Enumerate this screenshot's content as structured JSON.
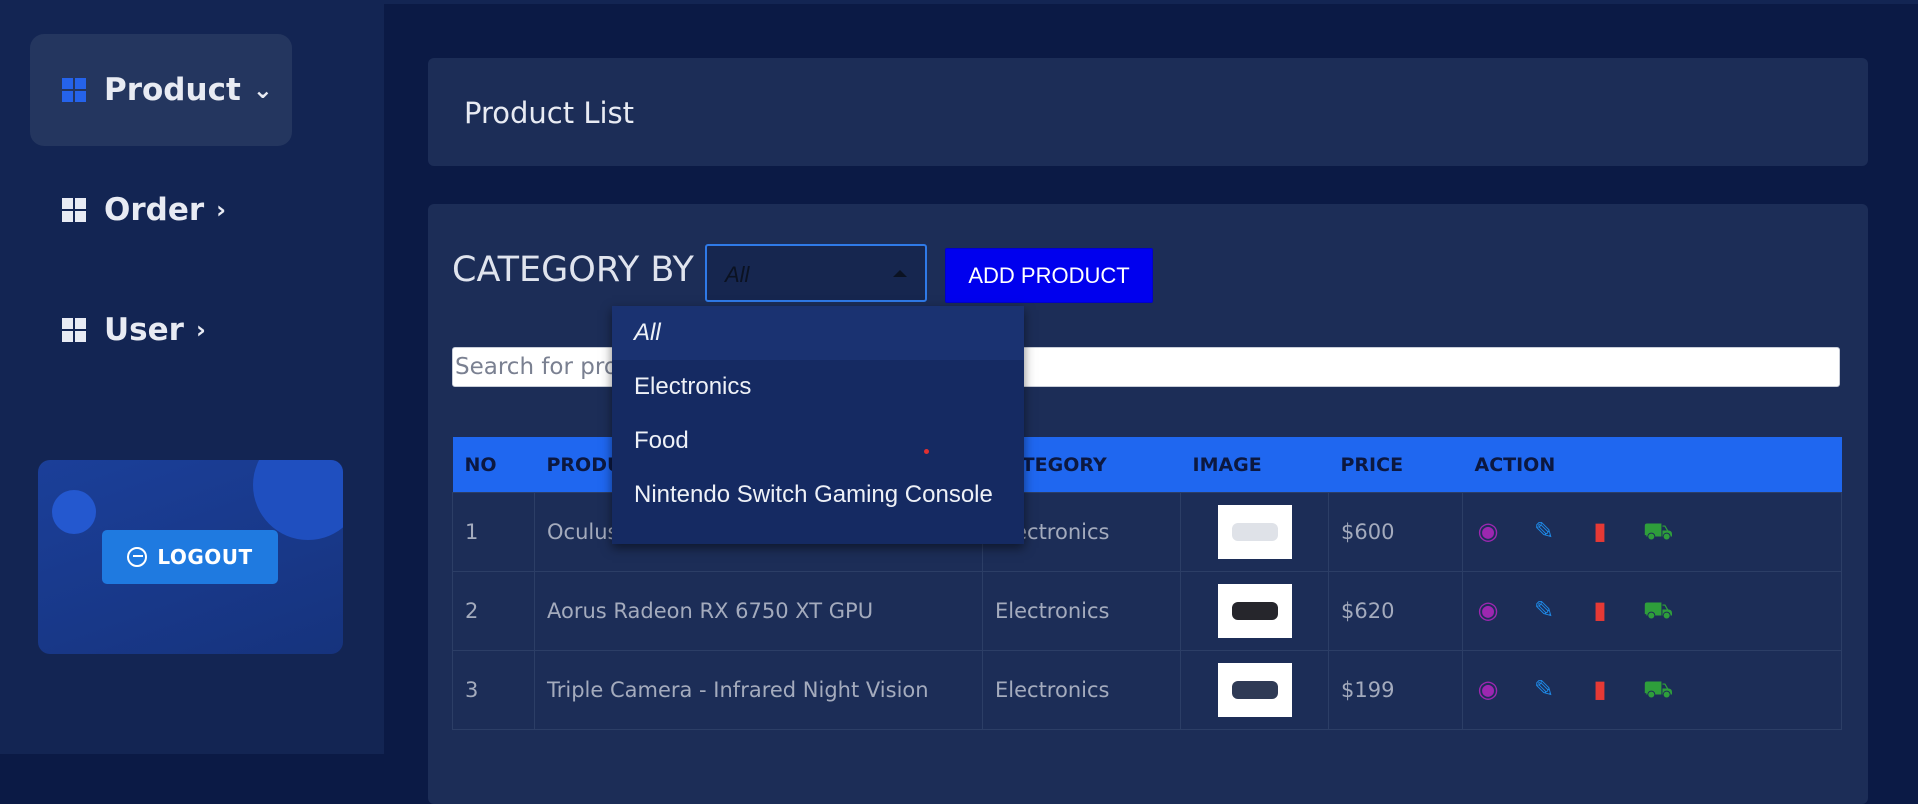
{
  "sidebar": {
    "items": [
      {
        "label": "Product",
        "icon": "dashboard-icon",
        "chevron": "chevron-down-icon"
      },
      {
        "label": "Order",
        "icon": "dashboard-icon",
        "chevron": "chevron-right-icon"
      },
      {
        "label": "User",
        "icon": "dashboard-icon",
        "chevron": "chevron-right-icon"
      }
    ],
    "logout_label": "LOGOUT"
  },
  "main": {
    "title": "Product List",
    "category_label": "CATEGORY BY",
    "category_selected": "All",
    "add_button": "ADD PRODUCT",
    "search_placeholder": "Search for products"
  },
  "dropdown": {
    "options": [
      "All",
      "Electronics",
      "Food",
      "Nintendo Switch Gaming Console"
    ]
  },
  "table": {
    "headers": [
      "NO",
      "PRODUCT",
      "CATEGORY",
      "IMAGE",
      "PRICE",
      "ACTION"
    ],
    "rows": [
      {
        "no": "1",
        "product": "Oculus",
        "category": "Electronics",
        "price": "$600"
      },
      {
        "no": "2",
        "product": "Aorus Radeon RX 6750 XT GPU",
        "category": "Electronics",
        "price": "$620"
      },
      {
        "no": "3",
        "product": "Triple Camera - Infrared Night Vision",
        "category": "Electronics",
        "price": "$199"
      }
    ]
  },
  "colors": {
    "accent": "#1f67f0",
    "add_button": "#0000ee",
    "view": "#9c27b0",
    "edit": "#1e88e5",
    "delete": "#e53935",
    "cart": "#2e9e3b"
  }
}
